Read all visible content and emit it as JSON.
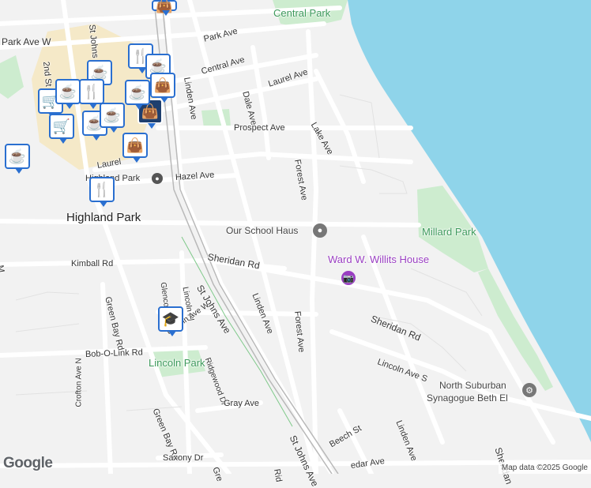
{
  "map": {
    "water_color": "#8fd4ea",
    "park_color": "#cdeccf",
    "road_color": "#ffffff",
    "land_color": "#f2f2f2"
  },
  "labels": {
    "central_park": "Central Park",
    "park_ave": "Park Ave",
    "park_ave_w": "Park Ave W",
    "central_ave": "Central Ave",
    "laurel_ave": "Laurel Ave",
    "dale_ave": "Dale Ave",
    "linden_ave_top": "Linden Ave",
    "lake_ave": "Lake Ave",
    "prospect_ave": "Prospect Ave",
    "forest_ave_top": "Forest Ave",
    "hazel_ave": "Hazel Ave",
    "laurel_left": "Laurel",
    "highland_park_station": "Highland Park",
    "highland_park_city": "Highland Park",
    "our_school_haus": "Our School Haus",
    "millard_park": "Millard Park",
    "ward_willits": "Ward W. Willits House",
    "kimball_rd": "Kimball Rd",
    "sheridan_rd_left": "Sheridan Rd",
    "sheridan_rd_right": "Sheridan Rd",
    "sheridan_rd_bottom": "Sheridan",
    "green_bay_rd": "Green Bay Rd",
    "green_bay_rd_bottom": "Green Bay Rd",
    "glencoe_ave": "Glencoe Ave",
    "lincoln_pl": "Lincoln Pl",
    "st_johns_ave": "St Johns Ave",
    "st_johns_ave_bottom": "St Johns Ave",
    "st_johns_top": "St Johns",
    "linden_ave_mid": "Linden Ave",
    "forest_ave_mid": "Forest Ave",
    "lincoln_ave_w": "Lincoln Ave W",
    "ridgewood_dr": "Ridgewood Dr",
    "bob_o_link_rd": "Bob-O-Link Rd",
    "lincoln_park": "Lincoln Park",
    "lincoln_ave_s": "Lincoln Ave S",
    "north_suburban_1": "North Suburban",
    "north_suburban_2": "Synagogue Beth El",
    "crofton_ave_n": "Crofton Ave N",
    "gray_ave": "Gray Ave",
    "linden_ave_bottom": "Linden Ave",
    "beech_st": "Beech St",
    "saxony_dr": "Saxony Dr",
    "cedar_ave": "edar Ave",
    "second_st": "2nd St",
    "gre": "Gre",
    "rid": "Rid",
    "m_left": "M"
  },
  "icons": {
    "coffee": "☕",
    "restaurant": "🍴",
    "shopping_cart": "🛒",
    "shopping_bag": "👜",
    "school": "🎓",
    "camera": "📷",
    "place": "⚙",
    "circle": "●"
  },
  "footer": {
    "google": "Google",
    "map_data": "Map data ©2025 Google"
  }
}
